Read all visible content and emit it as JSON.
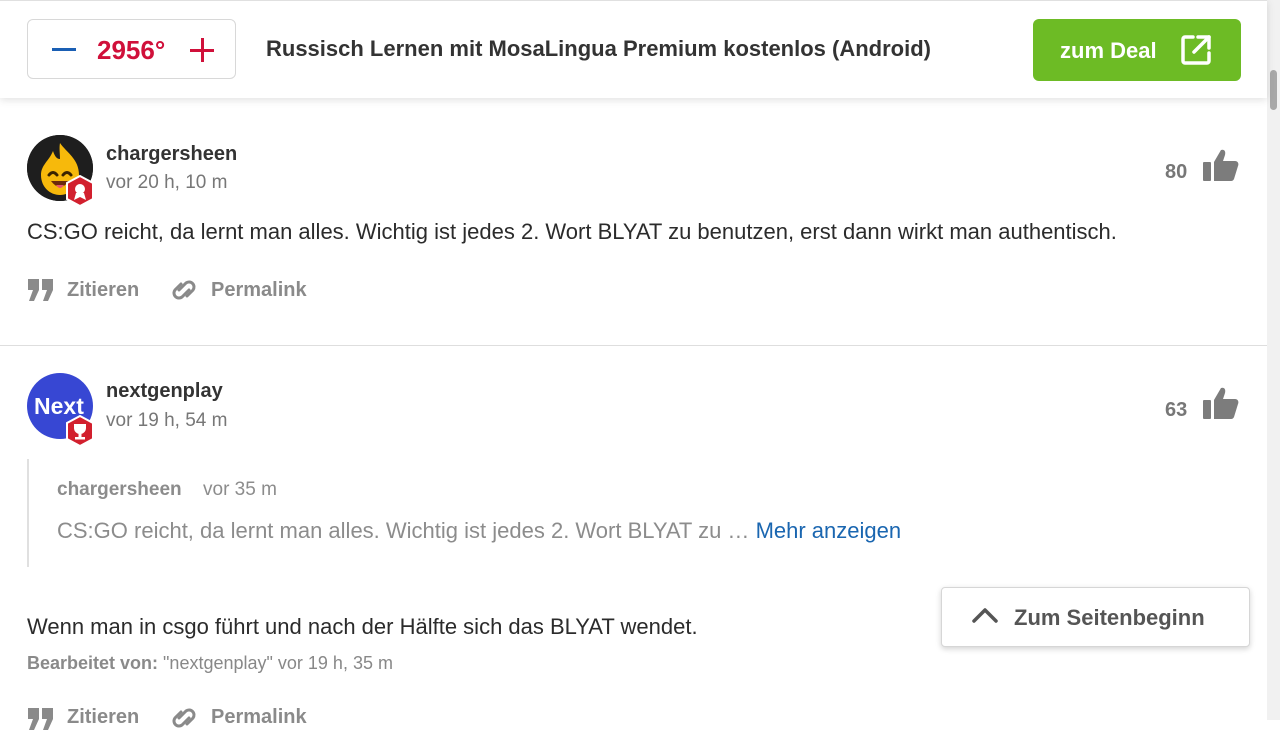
{
  "header": {
    "temperature": "2956°",
    "deal_title": "Russisch Lernen mit MosaLingua Premium kostenlos (Android)",
    "deal_button": "zum Deal",
    "colors": {
      "temperature": "#d0103a",
      "deal_button": "#6dbb25",
      "minus": "#1a5fb4"
    }
  },
  "comments": [
    {
      "username": "chargersheen",
      "time": "vor 20 h, 10 m",
      "likes": "80",
      "text": "CS:GO reicht, da lernt man alles. Wichtig ist jedes 2. Wort BLYAT zu benutzen, erst dann wirkt man authentisch.",
      "avatar": "flame-emoji-avatar"
    },
    {
      "username": "nextgenplay",
      "time": "vor 19 h, 54 m",
      "likes": "63",
      "avatar_text": "Next",
      "quote": {
        "username": "chargersheen",
        "time": "vor 35 m",
        "text": "CS:GO reicht, da lernt man alles. Wichtig ist jedes 2. Wort BLYAT zu …",
        "more": "Mehr anzeigen"
      },
      "text": "Wenn man in csgo führt und nach der Hälfte sich das BLYAT wendet.",
      "edited_label": "Bearbeitet von:",
      "edited_value": "\"nextgenplay\" vor 19 h, 35 m"
    }
  ],
  "actions": {
    "quote": "Zitieren",
    "permalink": "Permalink"
  },
  "scroll_top": "Zum Seitenbeginn"
}
